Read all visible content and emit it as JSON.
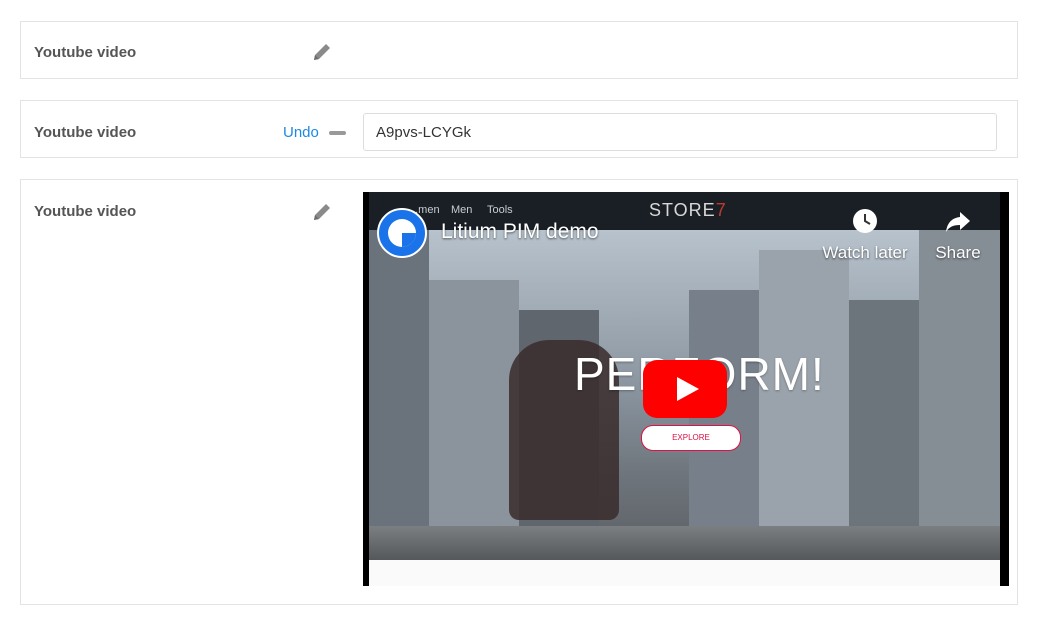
{
  "rows": [
    {
      "label": "Youtube video"
    },
    {
      "label": "Youtube video",
      "undo_label": "Undo",
      "input_value": "A9pvs-LCYGk"
    },
    {
      "label": "Youtube video"
    }
  ],
  "video": {
    "title": "Litium PIM demo",
    "watch_later": "Watch later",
    "share": "Share",
    "site_nav": [
      "...men",
      "Men",
      "Tools"
    ],
    "store_logo_main": "STORE",
    "store_logo_accent": "7",
    "hero_text": "PERFORM!",
    "explore_label": "EXPLORE"
  },
  "colors": {
    "accent": "#1e88e5",
    "youtube_red": "#ff0000",
    "border": "#e3e3e3"
  }
}
